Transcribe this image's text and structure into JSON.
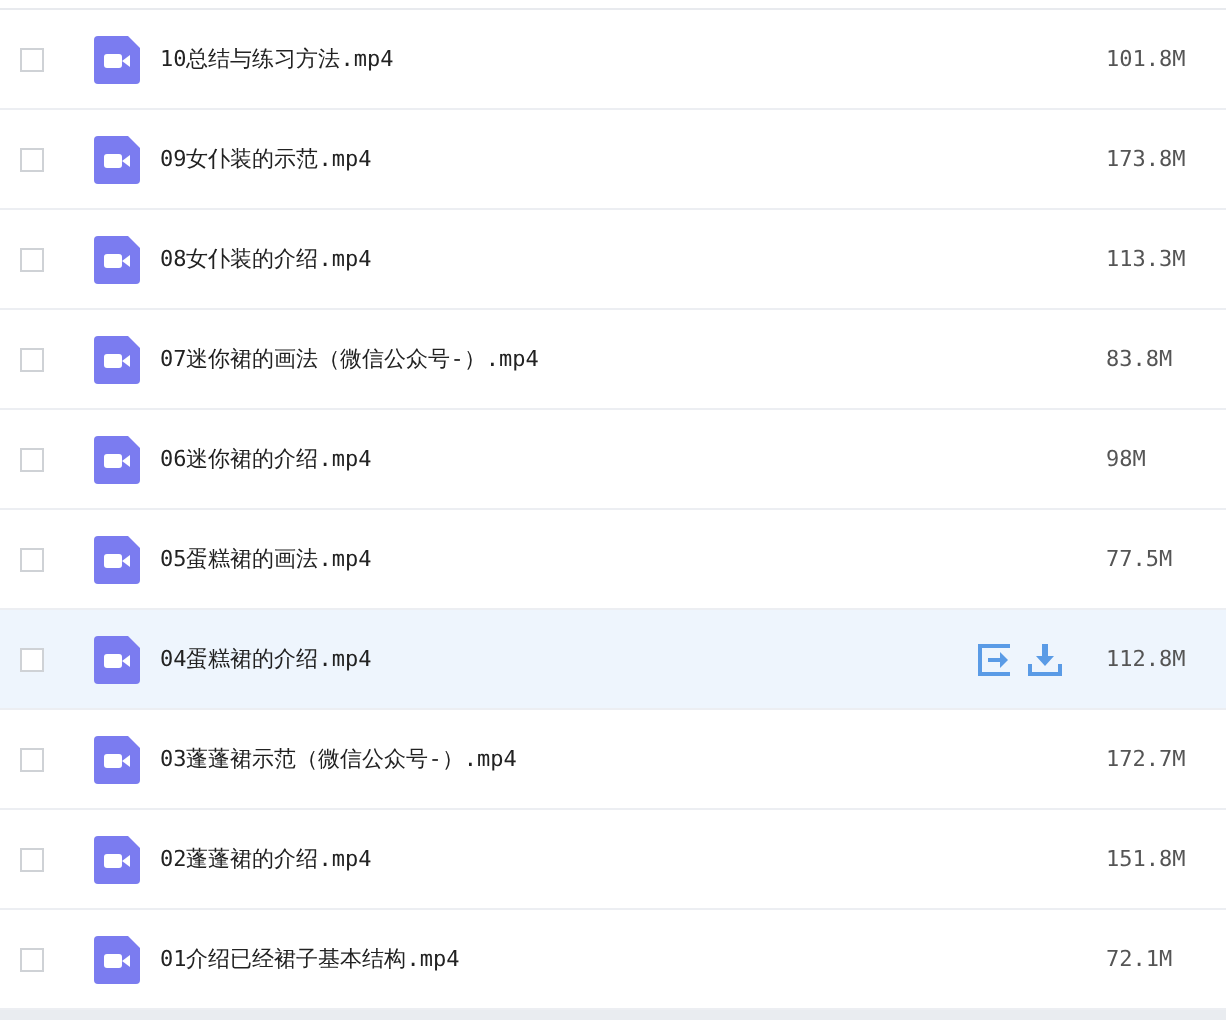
{
  "files": [
    {
      "name": "10总结与练习方法.mp4",
      "size": "101.8M",
      "checked": false,
      "hovered": false
    },
    {
      "name": "09女仆装的示范.mp4",
      "size": "173.8M",
      "checked": false,
      "hovered": false
    },
    {
      "name": "08女仆装的介绍.mp4",
      "size": "113.3M",
      "checked": false,
      "hovered": false
    },
    {
      "name": "07迷你裙的画法（微信公众号-）.mp4",
      "size": "83.8M",
      "checked": false,
      "hovered": false
    },
    {
      "name": "06迷你裙的介绍.mp4",
      "size": "98M",
      "checked": false,
      "hovered": false
    },
    {
      "name": "05蛋糕裙的画法.mp4",
      "size": "77.5M",
      "checked": false,
      "hovered": false
    },
    {
      "name": "04蛋糕裙的介绍.mp4",
      "size": "112.8M",
      "checked": false,
      "hovered": true
    },
    {
      "name": "03蓬蓬裙示范（微信公众号-）.mp4",
      "size": "172.7M",
      "checked": false,
      "hovered": false
    },
    {
      "name": "02蓬蓬裙的介绍.mp4",
      "size": "151.8M",
      "checked": false,
      "hovered": false
    },
    {
      "name": "01介绍已经裙子基本结构.mp4",
      "size": "72.1M",
      "checked": false,
      "hovered": false
    }
  ]
}
